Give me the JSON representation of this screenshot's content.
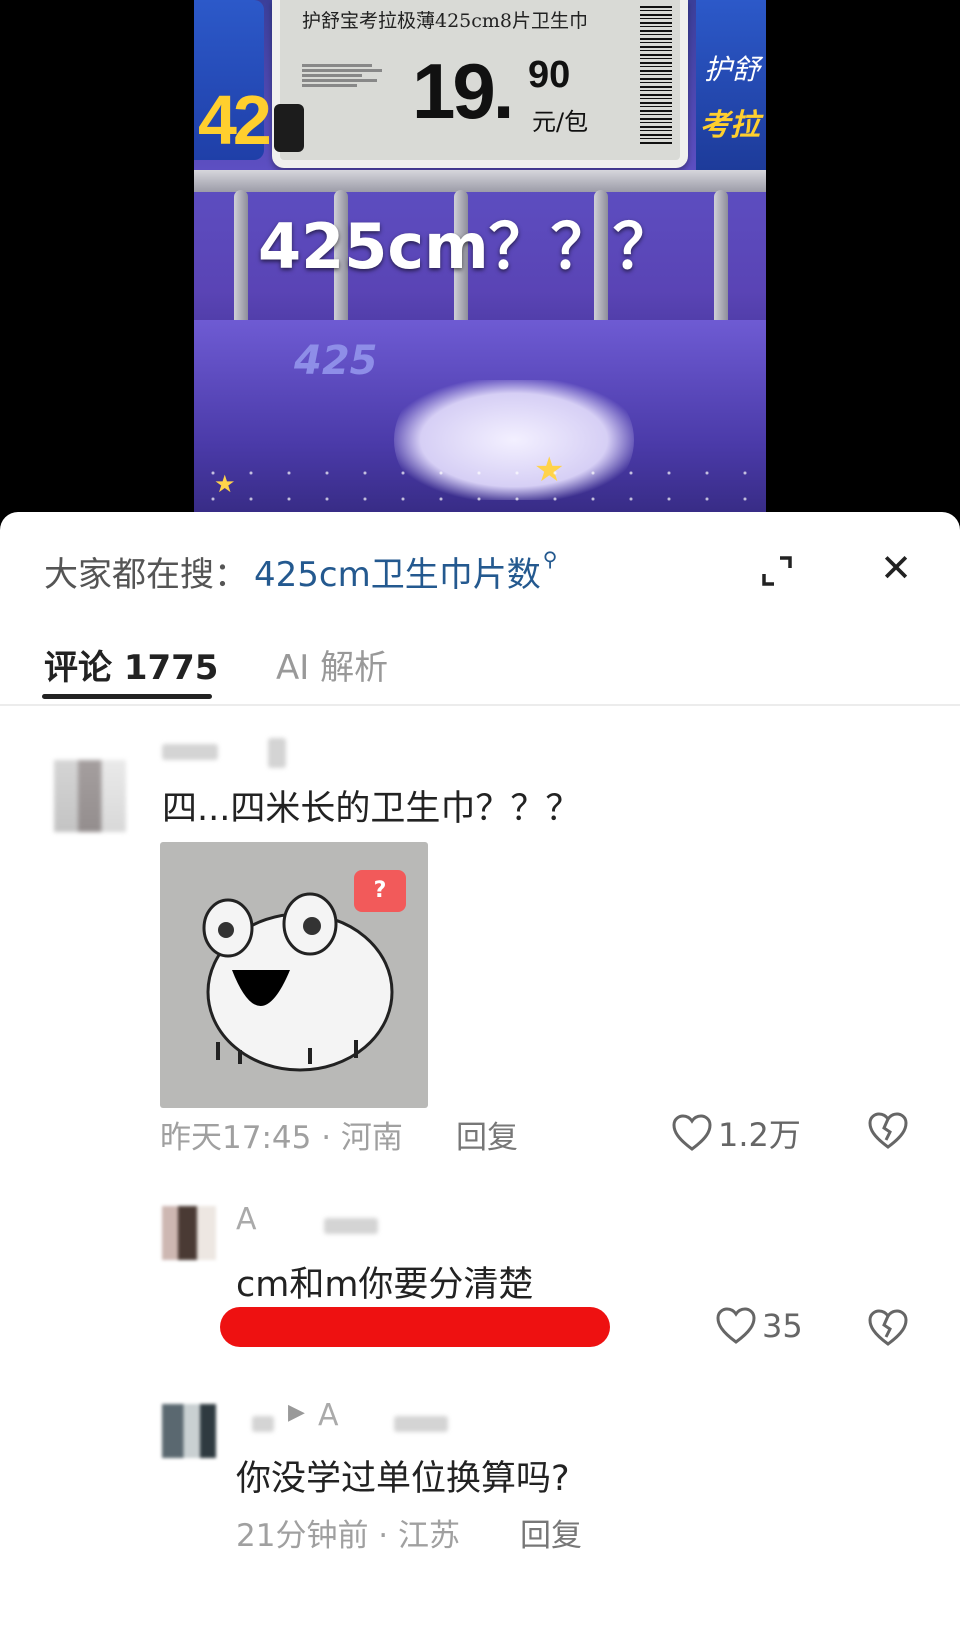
{
  "video": {
    "price_tag_title": "护舒宝考拉极薄425cm8片卫生巾",
    "price_int": "19.",
    "price_dec": "90",
    "price_unit": "元/包",
    "overlay_caption": "425cm？？？",
    "package_number": "42",
    "package_number_low": "425"
  },
  "search": {
    "prefix": "大家都在搜：",
    "term": "425cm卫生巾片数"
  },
  "tabs": [
    {
      "label": "评论 1775",
      "active": true
    },
    {
      "label": "AI 解析",
      "active": false
    }
  ],
  "comments": [
    {
      "name_initial": "",
      "text": "四...四米长的卫生巾？？？",
      "time": "昨天17:45",
      "location": "河南",
      "reply_label": "回复",
      "likes": "1.2万",
      "has_sticker": true
    },
    {
      "name_initial": "A",
      "text": "cm和m你要分清楚",
      "likes": "35"
    },
    {
      "name_initial": "A",
      "text": "你没学过单位换算吗?",
      "time": "21分钟前",
      "location": "江苏",
      "reply_label": "回复"
    }
  ],
  "sticker": {
    "badge": "?"
  },
  "colors": {
    "search_term": "#24598f",
    "redaction": "#ee1111"
  }
}
